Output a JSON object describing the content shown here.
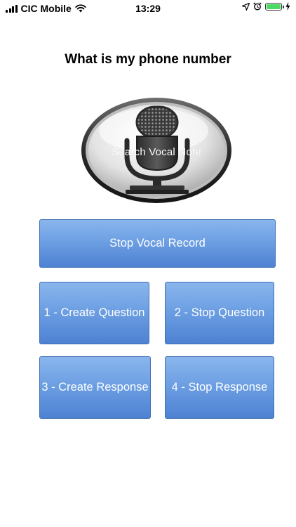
{
  "status_bar": {
    "carrier": "CIC Mobile",
    "time": "13:29",
    "battery_color": "#4cd964"
  },
  "title": "What is my phone number",
  "mic_button": {
    "label": "Search Vocal Note",
    "icon": "microphone-icon"
  },
  "buttons": {
    "stop_vocal_record": "Stop Vocal Record",
    "create_question": "1 - Create Question",
    "stop_question": "2 - Stop Question",
    "create_response": "3 - Create Response",
    "stop_response": "4 - Stop Response"
  },
  "colors": {
    "button_top": "#8ab6ec",
    "button_bottom": "#4e82d2",
    "button_text": "#ffffff"
  }
}
